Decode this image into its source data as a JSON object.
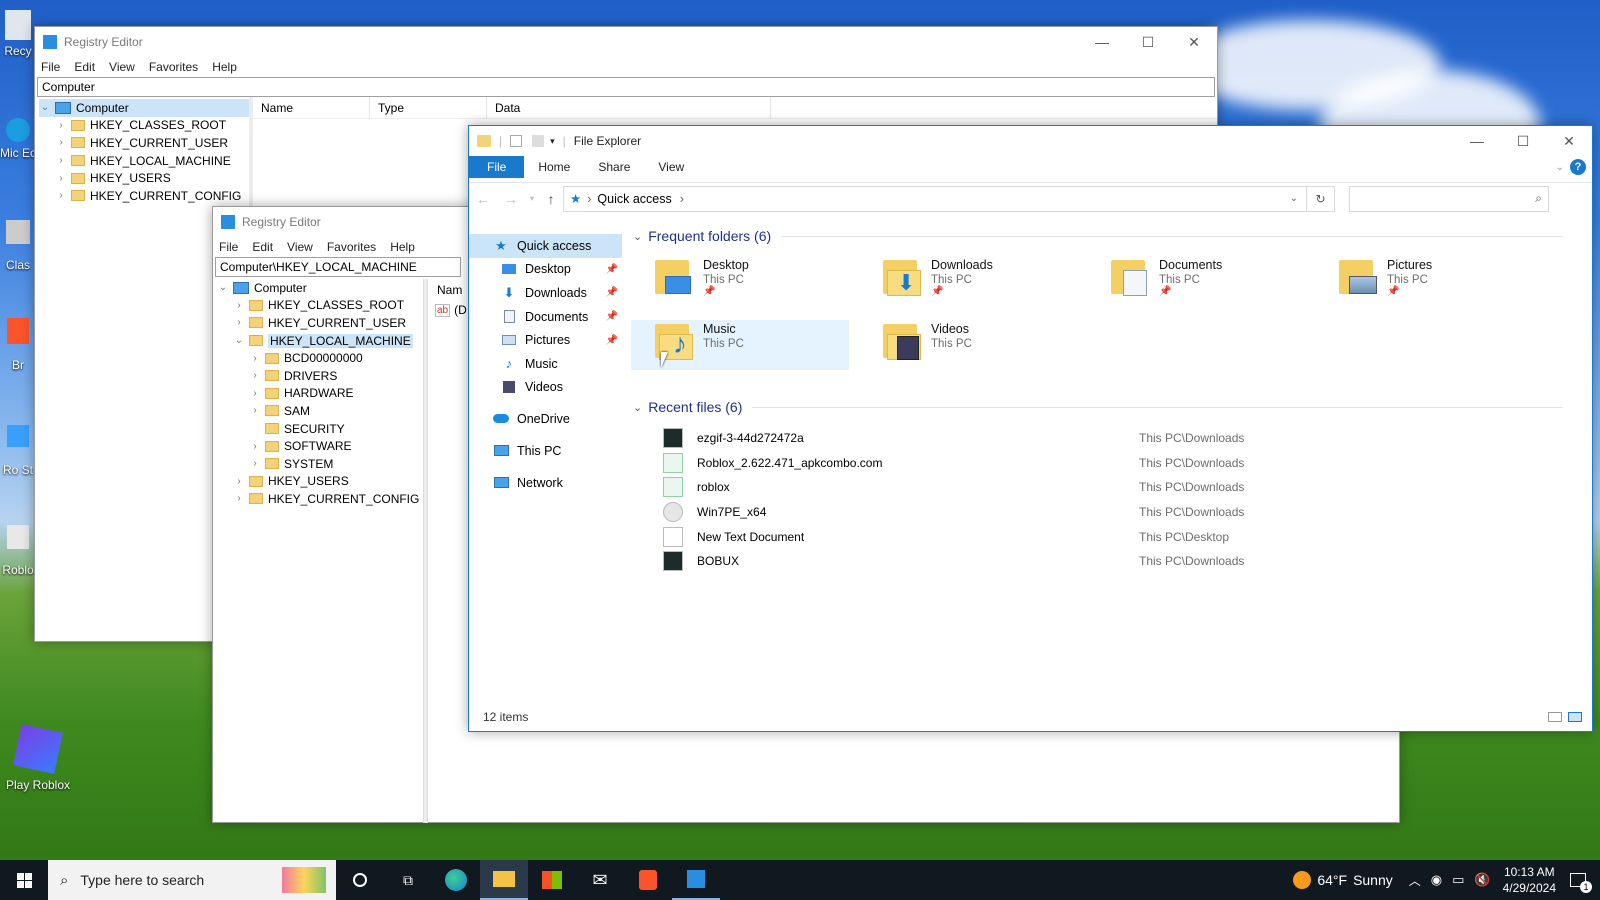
{
  "desktop": {
    "icons": [
      {
        "label": "Recy"
      },
      {
        "label": "Mic Ec"
      },
      {
        "label": "Clas"
      },
      {
        "label": "Br"
      },
      {
        "label": "Ro St"
      },
      {
        "label": "Roblo"
      },
      {
        "label": "Play Roblox"
      }
    ]
  },
  "reg_back": {
    "title": "Registry Editor",
    "menu": [
      "File",
      "Edit",
      "View",
      "Favorites",
      "Help"
    ],
    "address": "Computer",
    "tree_root": "Computer",
    "tree": [
      "HKEY_CLASSES_ROOT",
      "HKEY_CURRENT_USER",
      "HKEY_LOCAL_MACHINE",
      "HKEY_USERS",
      "HKEY_CURRENT_CONFIG"
    ],
    "columns": [
      "Name",
      "Type",
      "Data"
    ]
  },
  "reg_front": {
    "title": "Registry Editor",
    "menu": [
      "File",
      "Edit",
      "View",
      "Favorites",
      "Help"
    ],
    "address": "Computer\\HKEY_LOCAL_MACHINE",
    "tree_root": "Computer",
    "tree_top": [
      "HKEY_CLASSES_ROOT",
      "HKEY_CURRENT_USER",
      "HKEY_LOCAL_MACHINE"
    ],
    "tree_children": [
      "BCD00000000",
      "DRIVERS",
      "HARDWARE",
      "SAM",
      "SECURITY",
      "SOFTWARE",
      "SYSTEM"
    ],
    "tree_bottom": [
      "HKEY_USERS",
      "HKEY_CURRENT_CONFIG"
    ],
    "column_name": "Nam",
    "value_icon_text": "ab",
    "value_partial": "(D"
  },
  "explorer": {
    "title": "File Explorer",
    "tabs": [
      "File",
      "Home",
      "Share",
      "View"
    ],
    "help": "?",
    "breadcrumb": "Quick access",
    "search_placeholder": "",
    "nav": {
      "quick_access": "Quick access",
      "pinned": [
        "Desktop",
        "Downloads",
        "Documents",
        "Pictures"
      ],
      "unpinned": [
        "Music",
        "Videos"
      ],
      "onedrive": "OneDrive",
      "this_pc": "This PC",
      "network": "Network"
    },
    "frequent_header": "Frequent folders (6)",
    "frequent": [
      {
        "name": "Desktop",
        "sub": "This PC",
        "pinned": true
      },
      {
        "name": "Downloads",
        "sub": "This PC",
        "pinned": true
      },
      {
        "name": "Documents",
        "sub": "This PC",
        "pinned": true
      },
      {
        "name": "Pictures",
        "sub": "This PC",
        "pinned": true
      },
      {
        "name": "Music",
        "sub": "This PC",
        "pinned": false
      },
      {
        "name": "Videos",
        "sub": "This PC",
        "pinned": false
      }
    ],
    "recent_header": "Recent files (6)",
    "recent": [
      {
        "name": "ezgif-3-44d272472a",
        "location": "This PC\\Downloads"
      },
      {
        "name": "Roblox_2.622.471_apkcombo.com",
        "location": "This PC\\Downloads"
      },
      {
        "name": "roblox",
        "location": "This PC\\Downloads"
      },
      {
        "name": "Win7PE_x64",
        "location": "This PC\\Downloads"
      },
      {
        "name": "New Text Document",
        "location": "This PC\\Desktop"
      },
      {
        "name": "BOBUX",
        "location": "This PC\\Downloads"
      }
    ],
    "status": "12 items"
  },
  "taskbar": {
    "search_placeholder": "Type here to search",
    "weather_temp": "64°F",
    "weather_cond": "Sunny",
    "time": "10:13 AM",
    "date": "4/29/2024",
    "notification_count": "1"
  },
  "colors": {
    "accent": "#1979ca",
    "selection": "#cce4f7",
    "section_header": "#1e3287"
  }
}
